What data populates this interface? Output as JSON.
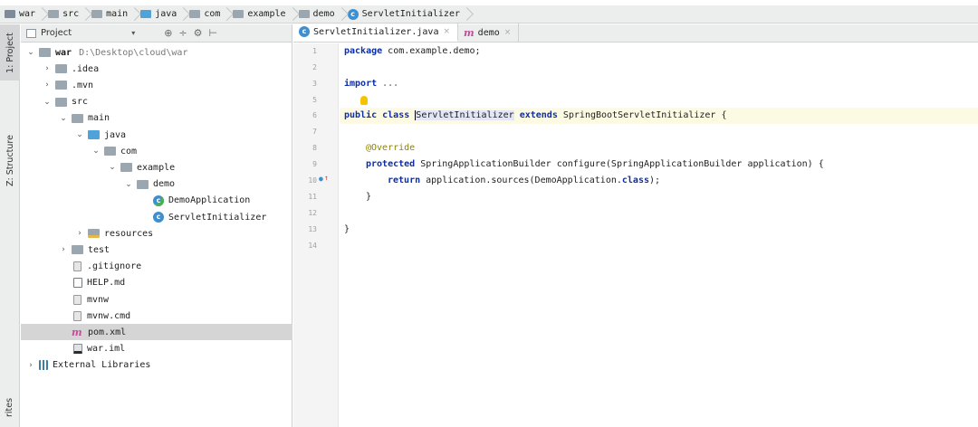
{
  "breadcrumb": [
    {
      "label": "war",
      "icon": "module-folder-icon"
    },
    {
      "label": "src",
      "icon": "folder-icon"
    },
    {
      "label": "main",
      "icon": "folder-icon"
    },
    {
      "label": "java",
      "icon": "source-folder-icon"
    },
    {
      "label": "com",
      "icon": "package-icon"
    },
    {
      "label": "example",
      "icon": "package-icon"
    },
    {
      "label": "demo",
      "icon": "package-icon"
    },
    {
      "label": "ServletInitializer",
      "icon": "class-icon"
    }
  ],
  "toolstrip": {
    "project_tab": "1: Project",
    "structure_tab": "Z: Structure",
    "favorites_tab": "rites"
  },
  "project_panel": {
    "title": "Project",
    "dropdown": "▾",
    "header_icons": [
      "⊕",
      "÷",
      "⚙",
      "⊢"
    ]
  },
  "tree": [
    {
      "depth": 0,
      "arrow": "⌄",
      "icon": "module",
      "label": "war",
      "extra": "D:\\Desktop\\cloud\\war"
    },
    {
      "depth": 1,
      "arrow": "›",
      "icon": "folder",
      "label": ".idea"
    },
    {
      "depth": 1,
      "arrow": "›",
      "icon": "folder",
      "label": ".mvn"
    },
    {
      "depth": 1,
      "arrow": "⌄",
      "icon": "folder",
      "label": "src"
    },
    {
      "depth": 2,
      "arrow": "⌄",
      "icon": "folder",
      "label": "main"
    },
    {
      "depth": 3,
      "arrow": "⌄",
      "icon": "blue",
      "label": "java"
    },
    {
      "depth": 4,
      "arrow": "⌄",
      "icon": "folder",
      "label": "com"
    },
    {
      "depth": 5,
      "arrow": "⌄",
      "icon": "folder",
      "label": "example"
    },
    {
      "depth": 6,
      "arrow": "⌄",
      "icon": "folder",
      "label": "demo"
    },
    {
      "depth": 7,
      "arrow": "",
      "icon": "spring",
      "label": "DemoApplication"
    },
    {
      "depth": 7,
      "arrow": "",
      "icon": "cls",
      "label": "ServletInitializer"
    },
    {
      "depth": 3,
      "arrow": "›",
      "icon": "res",
      "label": "resources"
    },
    {
      "depth": 2,
      "arrow": "›",
      "icon": "folder",
      "label": "test"
    },
    {
      "depth": 2,
      "arrow": "",
      "icon": "file",
      "label": ".gitignore"
    },
    {
      "depth": 2,
      "arrow": "",
      "icon": "md",
      "label": "HELP.md"
    },
    {
      "depth": 2,
      "arrow": "",
      "icon": "file",
      "label": "mvnw"
    },
    {
      "depth": 2,
      "arrow": "",
      "icon": "file",
      "label": "mvnw.cmd"
    },
    {
      "depth": 2,
      "arrow": "",
      "icon": "maven",
      "label": "pom.xml",
      "selected": true
    },
    {
      "depth": 2,
      "arrow": "",
      "icon": "iml",
      "label": "war.iml"
    },
    {
      "depth": 0,
      "arrow": "›",
      "icon": "lib",
      "label": "External Libraries"
    }
  ],
  "editor_tabs": [
    {
      "label": "ServletInitializer.java",
      "icon": "class-icon",
      "active": true,
      "close": "×"
    },
    {
      "label": "demo",
      "icon": "maven-icon",
      "active": false,
      "close": "×"
    }
  ],
  "line_numbers": [
    "1",
    "2",
    "3",
    "5",
    "6",
    "7",
    "8",
    "9",
    "10",
    "11",
    "12",
    "13",
    "14"
  ],
  "code": {
    "l1_kw": "package",
    "l1_rest": " com.example.demo;",
    "l3_kw": "import",
    "l3_rest": " ...",
    "l6_kw1": "public class ",
    "l6_pre": "",
    "l6_name_a": "S",
    "l6_name_b": "ervletInitializer",
    "l6_kw2": " extends",
    "l6_rest": " SpringBootServletInitializer {",
    "l8_ann": "@Override",
    "l9_kw": "protected",
    "l9_rest": " SpringApplicationBuilder configure(SpringApplicationBuilder application) {",
    "l10_kw": "return",
    "l10_mid": " application.sources(DemoApplication.",
    "l10_kw2": "class",
    "l10_end": ");",
    "l11": "}",
    "l13": "}"
  },
  "colors": {
    "keyword": "#0b2ea8",
    "annotation": "#8c8400",
    "maven": "#c24e9a",
    "class_icon": "#3d8fd0",
    "current_line": "#fdfae4"
  }
}
